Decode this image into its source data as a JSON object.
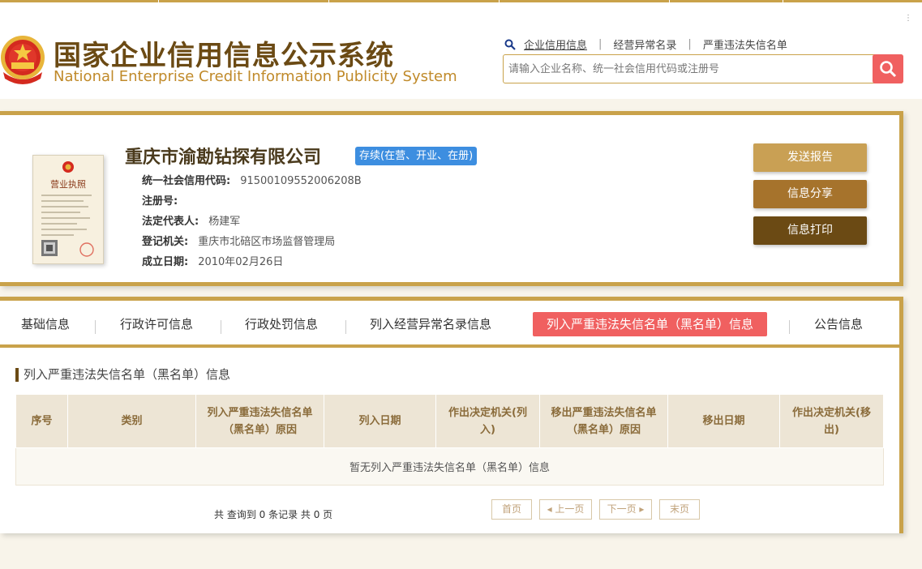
{
  "header": {
    "title_cn": "国家企业信用信息公示系统",
    "title_en": "National Enterprise Credit Information Publicity System",
    "nav": [
      "企业信用信息",
      "经营异常名录",
      "严重违法失信名单"
    ],
    "search_placeholder": "请输入企业名称、统一社会信用代码或注册号",
    "corner_dots": "⋮"
  },
  "company": {
    "name": "重庆市渝勘钻探有限公司",
    "status": "存续(在营、开业、在册)",
    "license_title": "营业执照",
    "fields": [
      {
        "label": "统一社会信用代码:",
        "value": "91500109552006208B"
      },
      {
        "label": "注册号:",
        "value": ""
      },
      {
        "label": "法定代表人:",
        "value": "杨建军"
      },
      {
        "label": "登记机关:",
        "value": "重庆市北碚区市场监督管理局"
      },
      {
        "label": "成立日期:",
        "value": "2010年02月26日"
      }
    ],
    "actions": [
      "发送报告",
      "信息分享",
      "信息打印"
    ]
  },
  "tabs": [
    {
      "label": "基础信息"
    },
    {
      "label": "行政许可信息"
    },
    {
      "label": "行政处罚信息"
    },
    {
      "label": "列入经营异常名录信息"
    },
    {
      "label": "列入严重违法失信名单（黑名单）信息"
    },
    {
      "label": "公告信息"
    }
  ],
  "section": {
    "title": "列入严重违法失信名单（黑名单）信息",
    "columns": [
      "序号",
      "类别",
      "列入严重违法失信名单（黑名单）原因",
      "列入日期",
      "作出决定机关(列入)",
      "移出严重违法失信名单（黑名单）原因",
      "移出日期",
      "作出决定机关(移出)"
    ],
    "empty_text": "暂无列入严重违法失信名单（黑名单）信息",
    "pagination_info": "共 查询到 0 条记录 共 0 页",
    "pager": {
      "first": "首页",
      "prev": "上一页",
      "next": "下一页",
      "last": "末页"
    }
  },
  "colors": {
    "gold": "#c9a24a",
    "red": "#f06060",
    "blue": "#3d8ee0",
    "brown_dark": "#6b4a14"
  }
}
